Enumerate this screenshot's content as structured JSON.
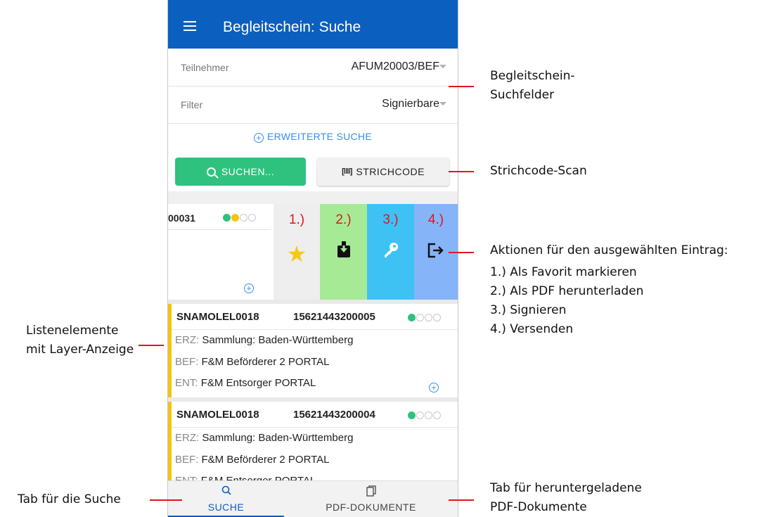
{
  "appbar": {
    "title": "Begleitschein: Suche"
  },
  "search": {
    "participant_label": "Teilnehmer",
    "participant_value": "AFUM20003/BEF",
    "filter_label": "Filter",
    "filter_value": "Signierbare",
    "extended_search": "ERWEITERTE SUCHE",
    "search_button": "SUCHEN...",
    "barcode_button": "STRICHCODE"
  },
  "swiped_item": {
    "number_partial": "00031",
    "layers": [
      "#2ec27e",
      "#f5c40f",
      "#ffffff",
      "#ffffff"
    ],
    "actions": [
      {
        "label": "1.)",
        "icon": "star-icon",
        "color": "#eeeeee"
      },
      {
        "label": "2.)",
        "icon": "download-icon",
        "color": "#a6ea96"
      },
      {
        "label": "3.)",
        "icon": "key-icon",
        "color": "#3ec2f4"
      },
      {
        "label": "4.)",
        "icon": "send-icon",
        "color": "#85b4f8"
      }
    ]
  },
  "list": [
    {
      "id": "SNAMOLEL0018",
      "number": "15621443200005",
      "erz_key": "ERZ:",
      "erz": "Sammlung: Baden-Württemberg",
      "bef_key": "BEF:",
      "bef": "F&M Beförderer 2 PORTAL",
      "ent_key": "ENT:",
      "ent": "F&M Entsorger PORTAL"
    },
    {
      "id": "SNAMOLEL0018",
      "number": "15621443200004",
      "erz_key": "ERZ:",
      "erz": "Sammlung: Baden-Württemberg",
      "bef_key": "BEF:",
      "bef": "F&M Beförderer 2 PORTAL",
      "ent_key": "ENT:",
      "ent": "F&M Entsorger PORTAL"
    }
  ],
  "tabs": {
    "search": "SUCHE",
    "pdf": "PDF-DOKUMENTE"
  },
  "annotations": {
    "search_fields_1": "Begleitschein-",
    "search_fields_2": "Suchfelder",
    "barcode_scan": "Strichcode-Scan",
    "actions_title": "Aktionen für den ausgewählten Eintrag:",
    "action_1": "1.) Als Favorit markieren",
    "action_2": "2.) Als PDF herunterladen",
    "action_3": "3.) Signieren",
    "action_4": "4.) Versenden",
    "list_items_1": "Listenelemente",
    "list_items_2": "mit Layer-Anzeige",
    "search_tab": "Tab für die Suche",
    "pdf_tab_1": "Tab für heruntergeladene",
    "pdf_tab_2": "PDF-Dokumente"
  }
}
